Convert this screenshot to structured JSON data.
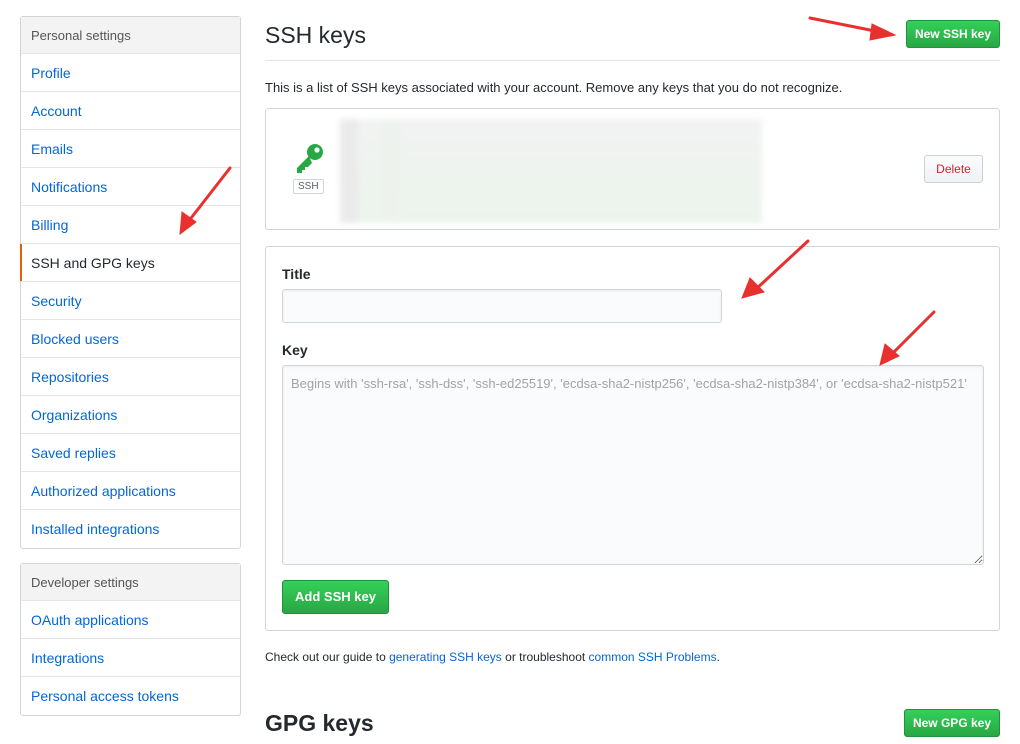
{
  "sidebar": {
    "personal": {
      "heading": "Personal settings",
      "items": [
        {
          "label": "Profile"
        },
        {
          "label": "Account"
        },
        {
          "label": "Emails"
        },
        {
          "label": "Notifications"
        },
        {
          "label": "Billing"
        },
        {
          "label": "SSH and GPG keys"
        },
        {
          "label": "Security"
        },
        {
          "label": "Blocked users"
        },
        {
          "label": "Repositories"
        },
        {
          "label": "Organizations"
        },
        {
          "label": "Saved replies"
        },
        {
          "label": "Authorized applications"
        },
        {
          "label": "Installed integrations"
        }
      ]
    },
    "developer": {
      "heading": "Developer settings",
      "items": [
        {
          "label": "OAuth applications"
        },
        {
          "label": "Integrations"
        },
        {
          "label": "Personal access tokens"
        }
      ]
    }
  },
  "ssh": {
    "title": "SSH keys",
    "new_button": "New SSH key",
    "intro": "This is a list of SSH keys associated with your account. Remove any keys that you do not recognize.",
    "key_badge": "SSH",
    "delete_button": "Delete"
  },
  "form": {
    "title_label": "Title",
    "title_value": "",
    "key_label": "Key",
    "key_placeholder": "Begins with 'ssh-rsa', 'ssh-dss', 'ssh-ed25519', 'ecdsa-sha2-nistp256', 'ecdsa-sha2-nistp384', or 'ecdsa-sha2-nistp521'",
    "submit_button": "Add SSH key"
  },
  "footer": {
    "prefix": "Check out our guide to ",
    "link1": "generating SSH keys",
    "middle": " or troubleshoot ",
    "link2": "common SSH Problems",
    "suffix": "."
  },
  "gpg": {
    "title": "GPG keys",
    "new_button": "New GPG key"
  },
  "colors": {
    "link": "#0366d6",
    "green": "#28a745",
    "selected_border": "#e36209",
    "delete_text": "#cb2431",
    "arrow": "#e8302f",
    "key_icon": "#28a745"
  }
}
